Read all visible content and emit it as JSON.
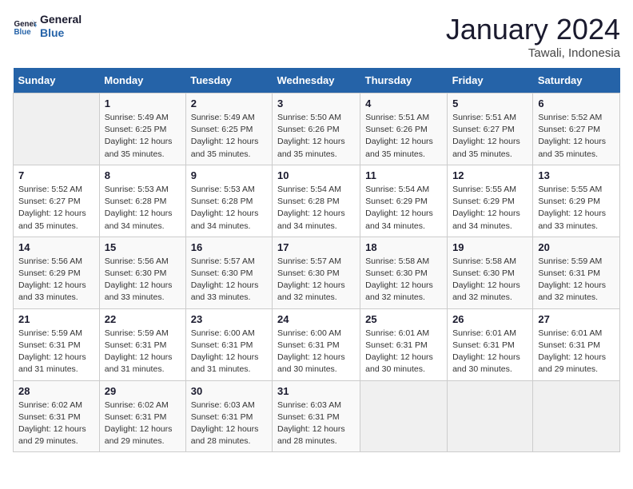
{
  "logo": {
    "line1": "General",
    "line2": "Blue"
  },
  "title": "January 2024",
  "subtitle": "Tawali, Indonesia",
  "days_of_week": [
    "Sunday",
    "Monday",
    "Tuesday",
    "Wednesday",
    "Thursday",
    "Friday",
    "Saturday"
  ],
  "weeks": [
    [
      {
        "day": "",
        "info": ""
      },
      {
        "day": "1",
        "info": "Sunrise: 5:49 AM\nSunset: 6:25 PM\nDaylight: 12 hours\nand 35 minutes."
      },
      {
        "day": "2",
        "info": "Sunrise: 5:49 AM\nSunset: 6:25 PM\nDaylight: 12 hours\nand 35 minutes."
      },
      {
        "day": "3",
        "info": "Sunrise: 5:50 AM\nSunset: 6:26 PM\nDaylight: 12 hours\nand 35 minutes."
      },
      {
        "day": "4",
        "info": "Sunrise: 5:51 AM\nSunset: 6:26 PM\nDaylight: 12 hours\nand 35 minutes."
      },
      {
        "day": "5",
        "info": "Sunrise: 5:51 AM\nSunset: 6:27 PM\nDaylight: 12 hours\nand 35 minutes."
      },
      {
        "day": "6",
        "info": "Sunrise: 5:52 AM\nSunset: 6:27 PM\nDaylight: 12 hours\nand 35 minutes."
      }
    ],
    [
      {
        "day": "7",
        "info": "Sunrise: 5:52 AM\nSunset: 6:27 PM\nDaylight: 12 hours\nand 35 minutes."
      },
      {
        "day": "8",
        "info": "Sunrise: 5:53 AM\nSunset: 6:28 PM\nDaylight: 12 hours\nand 34 minutes."
      },
      {
        "day": "9",
        "info": "Sunrise: 5:53 AM\nSunset: 6:28 PM\nDaylight: 12 hours\nand 34 minutes."
      },
      {
        "day": "10",
        "info": "Sunrise: 5:54 AM\nSunset: 6:28 PM\nDaylight: 12 hours\nand 34 minutes."
      },
      {
        "day": "11",
        "info": "Sunrise: 5:54 AM\nSunset: 6:29 PM\nDaylight: 12 hours\nand 34 minutes."
      },
      {
        "day": "12",
        "info": "Sunrise: 5:55 AM\nSunset: 6:29 PM\nDaylight: 12 hours\nand 34 minutes."
      },
      {
        "day": "13",
        "info": "Sunrise: 5:55 AM\nSunset: 6:29 PM\nDaylight: 12 hours\nand 33 minutes."
      }
    ],
    [
      {
        "day": "14",
        "info": "Sunrise: 5:56 AM\nSunset: 6:29 PM\nDaylight: 12 hours\nand 33 minutes."
      },
      {
        "day": "15",
        "info": "Sunrise: 5:56 AM\nSunset: 6:30 PM\nDaylight: 12 hours\nand 33 minutes."
      },
      {
        "day": "16",
        "info": "Sunrise: 5:57 AM\nSunset: 6:30 PM\nDaylight: 12 hours\nand 33 minutes."
      },
      {
        "day": "17",
        "info": "Sunrise: 5:57 AM\nSunset: 6:30 PM\nDaylight: 12 hours\nand 32 minutes."
      },
      {
        "day": "18",
        "info": "Sunrise: 5:58 AM\nSunset: 6:30 PM\nDaylight: 12 hours\nand 32 minutes."
      },
      {
        "day": "19",
        "info": "Sunrise: 5:58 AM\nSunset: 6:30 PM\nDaylight: 12 hours\nand 32 minutes."
      },
      {
        "day": "20",
        "info": "Sunrise: 5:59 AM\nSunset: 6:31 PM\nDaylight: 12 hours\nand 32 minutes."
      }
    ],
    [
      {
        "day": "21",
        "info": "Sunrise: 5:59 AM\nSunset: 6:31 PM\nDaylight: 12 hours\nand 31 minutes."
      },
      {
        "day": "22",
        "info": "Sunrise: 5:59 AM\nSunset: 6:31 PM\nDaylight: 12 hours\nand 31 minutes."
      },
      {
        "day": "23",
        "info": "Sunrise: 6:00 AM\nSunset: 6:31 PM\nDaylight: 12 hours\nand 31 minutes."
      },
      {
        "day": "24",
        "info": "Sunrise: 6:00 AM\nSunset: 6:31 PM\nDaylight: 12 hours\nand 30 minutes."
      },
      {
        "day": "25",
        "info": "Sunrise: 6:01 AM\nSunset: 6:31 PM\nDaylight: 12 hours\nand 30 minutes."
      },
      {
        "day": "26",
        "info": "Sunrise: 6:01 AM\nSunset: 6:31 PM\nDaylight: 12 hours\nand 30 minutes."
      },
      {
        "day": "27",
        "info": "Sunrise: 6:01 AM\nSunset: 6:31 PM\nDaylight: 12 hours\nand 29 minutes."
      }
    ],
    [
      {
        "day": "28",
        "info": "Sunrise: 6:02 AM\nSunset: 6:31 PM\nDaylight: 12 hours\nand 29 minutes."
      },
      {
        "day": "29",
        "info": "Sunrise: 6:02 AM\nSunset: 6:31 PM\nDaylight: 12 hours\nand 29 minutes."
      },
      {
        "day": "30",
        "info": "Sunrise: 6:03 AM\nSunset: 6:31 PM\nDaylight: 12 hours\nand 28 minutes."
      },
      {
        "day": "31",
        "info": "Sunrise: 6:03 AM\nSunset: 6:31 PM\nDaylight: 12 hours\nand 28 minutes."
      },
      {
        "day": "",
        "info": ""
      },
      {
        "day": "",
        "info": ""
      },
      {
        "day": "",
        "info": ""
      }
    ]
  ]
}
